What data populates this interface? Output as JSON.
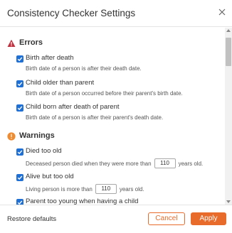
{
  "dialog": {
    "title": "Consistency Checker Settings"
  },
  "errors": {
    "title": "Errors",
    "rules": [
      {
        "label": "Birth after death",
        "description": "Birth date of a person is after their death date.",
        "checked": true
      },
      {
        "label": "Child older than parent",
        "description": "Birth date of a person occurred before their parent's birth date.",
        "checked": true
      },
      {
        "label": "Child born after death of parent",
        "description": "Birth date of a person is after their parent's death date.",
        "checked": true
      }
    ]
  },
  "warnings": {
    "title": "Warnings",
    "rules": [
      {
        "label": "Died too old",
        "description_before": "Deceased person died when they were more than",
        "value": "110",
        "description_after": "years old.",
        "checked": true
      },
      {
        "label": "Alive but too old",
        "description_before": "Living person is more than",
        "value": "110",
        "description_after": "years old.",
        "checked": true
      },
      {
        "label": "Parent too young when having a child",
        "checked": true
      }
    ]
  },
  "footer": {
    "restore_label": "Restore defaults",
    "cancel_label": "Cancel",
    "apply_label": "Apply"
  },
  "colors": {
    "accent": "#e96b2b",
    "checkbox": "#1e6fd6",
    "error_icon": "#c0323f",
    "warning_icon": "#ef8c32"
  }
}
